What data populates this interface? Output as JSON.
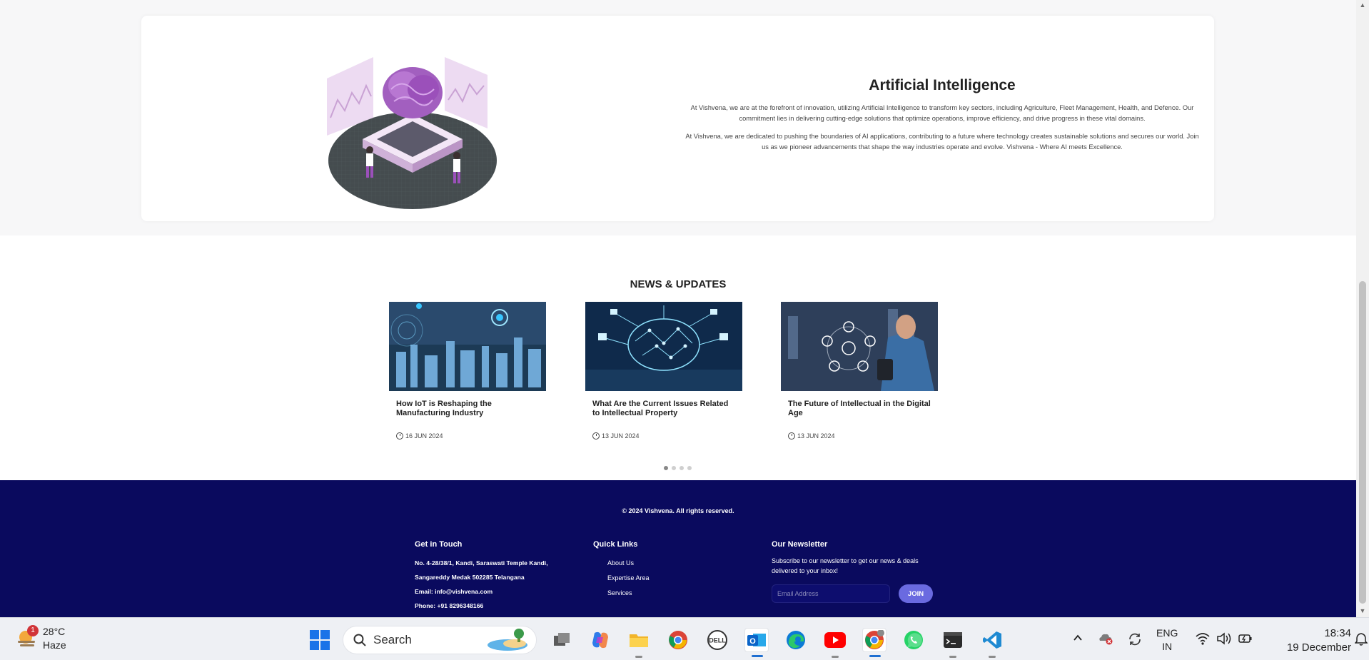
{
  "ai": {
    "title": "Artificial Intelligence",
    "para1": "At Vishvena, we are at the forefront of innovation, utilizing Artificial Intelligence to transform key sectors, including Agriculture, Fleet Management, Health, and Defence. Our commitment lies in delivering cutting-edge solutions that optimize operations, improve efficiency, and drive progress in these vital domains.",
    "para2": "At Vishvena, we are dedicated to pushing the boundaries of AI applications, contributing to a future where technology creates sustainable solutions and secures our world. Join us as we pioneer advancements that shape the way industries operate and evolve. Vishvena - Where AI meets Excellence."
  },
  "news": {
    "title": "NEWS & UPDATES",
    "items": [
      {
        "headline": "How IoT is Reshaping the Manufacturing Industry",
        "date": "16 JUN 2024"
      },
      {
        "headline": "What Are the Current Issues Related to Intellectual Property",
        "date": "13 JUN 2024"
      },
      {
        "headline": "The Future of Intellectual in the Digital Age",
        "date": "13 JUN 2024"
      }
    ],
    "dot_count": 4,
    "active_dot": 0
  },
  "footer": {
    "copyright": "© 2024 Vishvena. All rights reserved.",
    "contact": {
      "title": "Get in Touch",
      "address1": "No. 4-28/38/1, Kandi, Saraswati Temple Kandi,",
      "address2": "Sangareddy Medak 502285 Telangana",
      "email": "Email: info@vishvena.com",
      "phone": "Phone: +91 8296348166"
    },
    "quick_links": {
      "title": "Quick Links",
      "links": [
        "About Us",
        "Expertise Area",
        "Services"
      ]
    },
    "newsletter": {
      "title": "Our Newsletter",
      "desc": "Subscribe to our newsletter to get our news & deals delivered to your inbox!",
      "placeholder": "Email Address",
      "button": "JOIN"
    }
  },
  "taskbar": {
    "weather_temp": "28°C",
    "weather_desc": "Haze",
    "weather_badge": "1",
    "search_label": "Search",
    "lang_top": "ENG",
    "lang_bottom": "IN",
    "time": "18:34",
    "date": "19 December",
    "apps": [
      "task-view",
      "copilot",
      "file-explorer",
      "chrome",
      "dell",
      "outlook",
      "edge",
      "youtube",
      "chrome-profile",
      "whatsapp",
      "terminal",
      "vscode"
    ]
  },
  "colors": {
    "footer_bg": "#0a0a5e",
    "join_button": "#6a6ae0",
    "accent_blue": "#1f6fd1"
  }
}
